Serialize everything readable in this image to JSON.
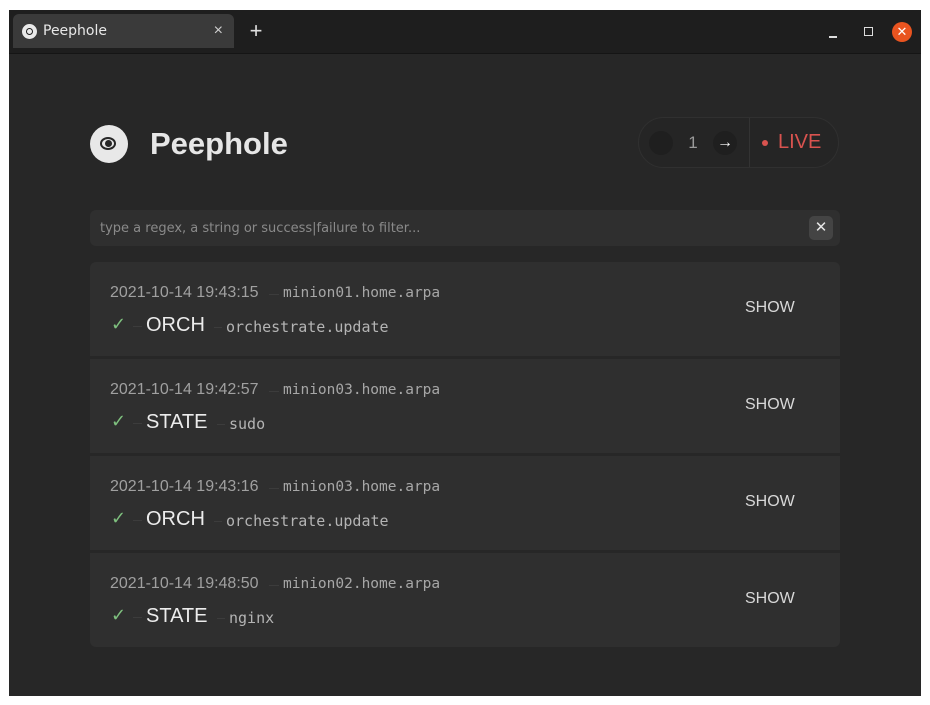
{
  "window": {
    "tab_title": "Peephole",
    "tab_close": "×",
    "new_tab": "+",
    "minimize": "",
    "maximize": "",
    "close": "✕"
  },
  "header": {
    "app_title": "Peephole",
    "logo_icon": "eye-icon"
  },
  "pager": {
    "prev_icon": "←",
    "page": "1",
    "next_icon": "→",
    "live_label": "LIVE",
    "live_color": "#d9534f"
  },
  "filter": {
    "value": "",
    "placeholder": "type a regex, a string or success|failure to filter...",
    "clear": "✕"
  },
  "jobs": [
    {
      "timestamp": "2021-10-14 19:43:15",
      "minion": "minion01.home.arpa",
      "status": "✓",
      "kind": "ORCH",
      "function": "orchestrate.update",
      "action": "SHOW"
    },
    {
      "timestamp": "2021-10-14 19:42:57",
      "minion": "minion03.home.arpa",
      "status": "✓",
      "kind": "STATE",
      "function": "sudo",
      "action": "SHOW"
    },
    {
      "timestamp": "2021-10-14 19:43:16",
      "minion": "minion03.home.arpa",
      "status": "✓",
      "kind": "ORCH",
      "function": "orchestrate.update",
      "action": "SHOW"
    },
    {
      "timestamp": "2021-10-14 19:48:50",
      "minion": "minion02.home.arpa",
      "status": "✓",
      "kind": "STATE",
      "function": "nginx",
      "action": "SHOW"
    }
  ],
  "colors": {
    "background": "#272727",
    "card": "#2f2f2f",
    "success": "#7ec07e",
    "window_close": "#e95420"
  }
}
